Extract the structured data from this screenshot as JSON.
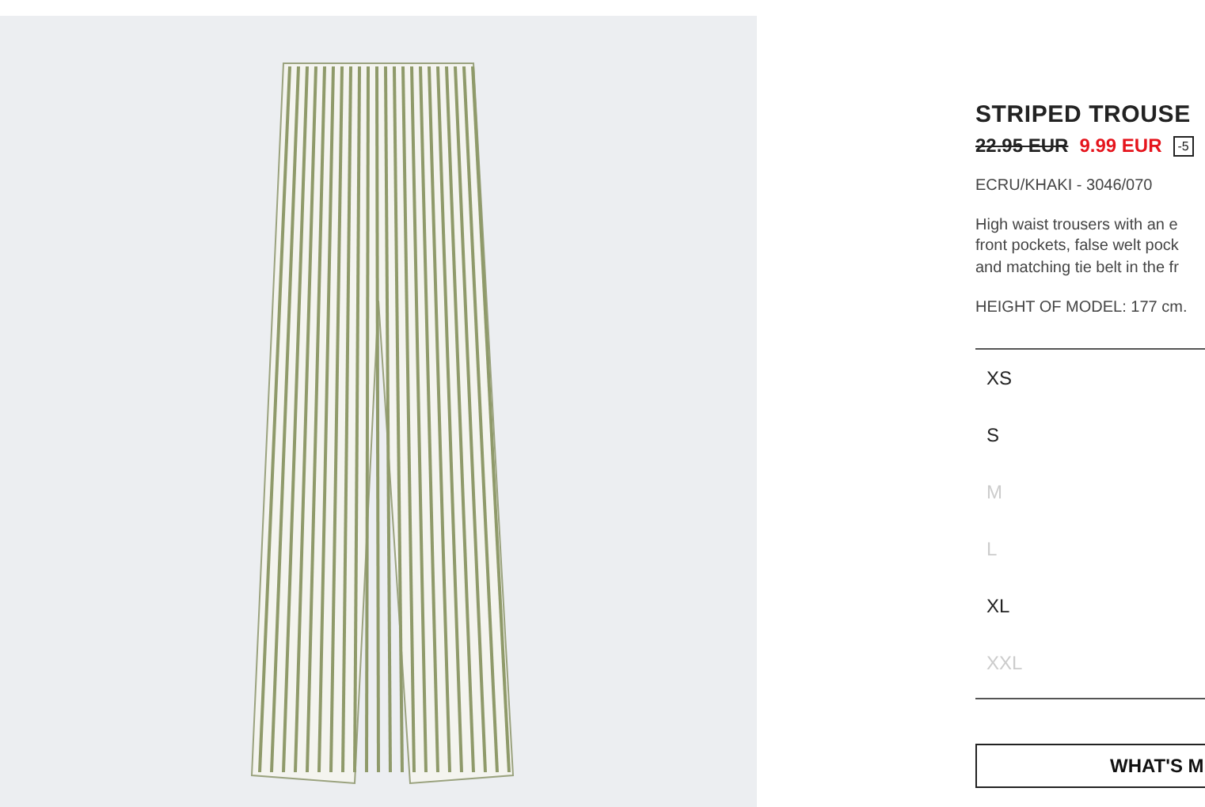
{
  "product": {
    "title": "STRIPED TROUSE",
    "old_price": "22.95 EUR",
    "price": "9.99 EUR",
    "discount": "-5",
    "color_ref": "ECRU/KHAKI - 3046/070",
    "description": [
      "High waist trousers with an e",
      "front pockets, false welt pock",
      "and matching tie belt in the fr"
    ],
    "model_height": "HEIGHT OF MODEL: 177 cm."
  },
  "sizes": [
    {
      "label": "XS",
      "disabled": false
    },
    {
      "label": "S",
      "disabled": false
    },
    {
      "label": "M",
      "disabled": true
    },
    {
      "label": "L",
      "disabled": true
    },
    {
      "label": "XL",
      "disabled": false
    },
    {
      "label": "XXL",
      "disabled": true
    }
  ],
  "button": "WHAT'S M"
}
